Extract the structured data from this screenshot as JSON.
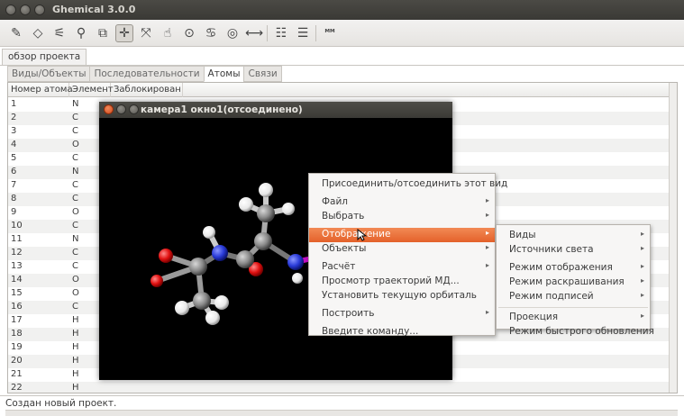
{
  "window": {
    "title": "Ghemical 3.0.0"
  },
  "toolbar": {
    "icons": [
      "draw-icon",
      "erase-icon",
      "select-icon",
      "zoom-icon",
      "clipping-icon",
      "translate-xy-icon",
      "translate-z-icon",
      "orbit-xy-icon",
      "orbit-z-icon",
      "rotate-xy-icon",
      "rotate-z-icon",
      "measure-icon",
      "element-icon",
      "bondtype-icon",
      "mm-icon"
    ]
  },
  "project": {
    "label": "обзор проекта"
  },
  "tabs": [
    {
      "label": "Виды/Объекты"
    },
    {
      "label": "Последовательности"
    },
    {
      "label": "Атомы"
    },
    {
      "label": "Связи"
    }
  ],
  "table": {
    "headers": [
      "Номер атома",
      "Элемент",
      "Заблокирован"
    ],
    "rows": [
      [
        "1",
        "N"
      ],
      [
        "2",
        "C"
      ],
      [
        "3",
        "C"
      ],
      [
        "4",
        "O"
      ],
      [
        "5",
        "C"
      ],
      [
        "6",
        "N"
      ],
      [
        "7",
        "C"
      ],
      [
        "8",
        "C"
      ],
      [
        "9",
        "O"
      ],
      [
        "10",
        "C"
      ],
      [
        "11",
        "N"
      ],
      [
        "12",
        "C"
      ],
      [
        "13",
        "C"
      ],
      [
        "14",
        "O"
      ],
      [
        "15",
        "O"
      ],
      [
        "16",
        "C"
      ],
      [
        "17",
        "H"
      ],
      [
        "18",
        "H"
      ],
      [
        "19",
        "H"
      ],
      [
        "20",
        "H"
      ],
      [
        "21",
        "H"
      ],
      [
        "22",
        "H"
      ]
    ]
  },
  "camera_window": {
    "title": "камера1 окно1(отсоединено)"
  },
  "context_menu": {
    "items": [
      {
        "label": "Присоединить/отсоединить этот вид",
        "submenu": false
      },
      {
        "label": "Файл",
        "submenu": true
      },
      {
        "label": "Выбрать",
        "submenu": true
      },
      {
        "label": "Отображение",
        "submenu": true
      },
      {
        "label": "Объекты",
        "submenu": true
      },
      {
        "label": "Расчёт",
        "submenu": true
      },
      {
        "label": "Просмотр траекторий МД...",
        "submenu": false
      },
      {
        "label": "Установить текущую орбиталь",
        "submenu": false
      },
      {
        "label": "Построить",
        "submenu": true
      },
      {
        "label": "Введите команду...",
        "submenu": false
      }
    ]
  },
  "submenu": {
    "items": [
      {
        "label": "Виды",
        "submenu": true
      },
      {
        "label": "Источники света",
        "submenu": true
      },
      {
        "label": "Режим отображения",
        "submenu": true
      },
      {
        "label": "Режим раскрашивания",
        "submenu": true
      },
      {
        "label": "Режим подписей",
        "submenu": true
      },
      {
        "label": "Проекция",
        "submenu": true
      },
      {
        "label": "Режим быстрого обновления",
        "submenu": false
      }
    ]
  },
  "status": {
    "text": "Создан новый проект."
  },
  "colors": {
    "highlight": "#e96a33",
    "titlebar": "#3c3b37",
    "oxygen": "#e01010",
    "nitrogen": "#2a3bd8",
    "carbon": "#8a8a8a",
    "hydrogen": "#f0f0f0"
  }
}
